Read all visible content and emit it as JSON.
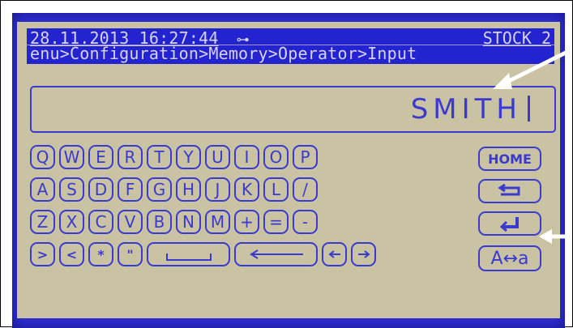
{
  "header": {
    "datetime": "28.11.2013 16:27:44",
    "stock": "STOCK 2",
    "breadcrumb": "enu>Configuration>Memory>Operator>Input"
  },
  "input": {
    "value": "SMITH"
  },
  "keyboard": {
    "rows": [
      [
        "Q",
        "W",
        "E",
        "R",
        "T",
        "Y",
        "U",
        "I",
        "O",
        "P"
      ],
      [
        "A",
        "S",
        "D",
        "F",
        "G",
        "H",
        "J",
        "K",
        "L",
        "/"
      ],
      [
        "Z",
        "X",
        "C",
        "V",
        "B",
        "N",
        "M",
        "+",
        "=",
        "-"
      ],
      [
        ">",
        "<",
        "*",
        "\""
      ]
    ],
    "side": {
      "home": "HOME",
      "case": "A↔a"
    }
  },
  "colors": {
    "lcd": "#c9c2a3",
    "accent": "#3a3ad0",
    "bezel": "#2f2fd8"
  }
}
